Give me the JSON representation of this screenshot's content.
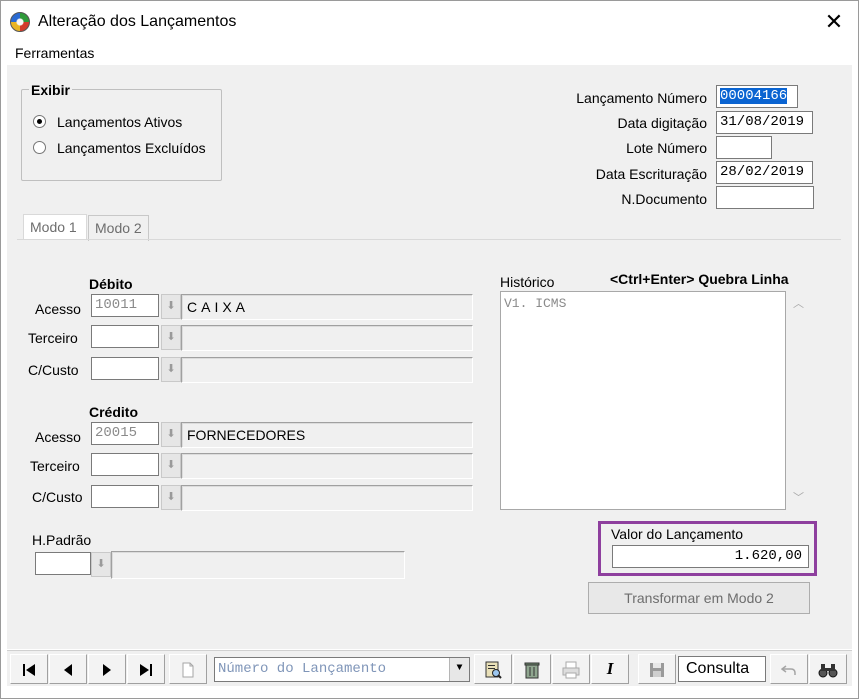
{
  "window": {
    "title": "Alteração dos Lançamentos",
    "close": "✕"
  },
  "menu": {
    "items": [
      "Ferramentas"
    ]
  },
  "exibir": {
    "title": "Exibir",
    "options": [
      {
        "label": "Lançamentos Ativos",
        "checked": true
      },
      {
        "label": "Lançamentos Excluídos",
        "checked": false
      }
    ]
  },
  "header_fields": {
    "lancamento_numero": {
      "label": "Lançamento Número",
      "value": "00004166"
    },
    "data_digitacao": {
      "label": "Data digitação",
      "value": "31/08/2019"
    },
    "lote_numero": {
      "label": "Lote Número",
      "value": ""
    },
    "data_escrituracao": {
      "label": "Data Escrituração",
      "value": "28/02/2019"
    },
    "n_documento": {
      "label": "N.Documento",
      "value": ""
    }
  },
  "tabs": [
    {
      "label": "Modo 1",
      "active": true
    },
    {
      "label": "Modo 2",
      "active": false
    }
  ],
  "debito": {
    "title": "Débito",
    "rows": [
      {
        "label": "Acesso",
        "code": "10011",
        "name": "CAIXA"
      },
      {
        "label": "Terceiro",
        "code": "",
        "name": ""
      },
      {
        "label": "C/Custo",
        "code": "",
        "name": ""
      }
    ]
  },
  "credito": {
    "title": "Crédito",
    "rows": [
      {
        "label": "Acesso",
        "code": "20015",
        "name": "FORNECEDORES"
      },
      {
        "label": "Terceiro",
        "code": "",
        "name": ""
      },
      {
        "label": "C/Custo",
        "code": "",
        "name": ""
      }
    ]
  },
  "hpadrao": {
    "label": "H.Padrão",
    "code": "",
    "name": ""
  },
  "historico": {
    "label": "Histórico",
    "hint": "<Ctrl+Enter> Quebra Linha",
    "text": "V1. ICMS"
  },
  "valor": {
    "label": "Valor do Lançamento",
    "value": "1.620,00"
  },
  "transform_button": "Transformar em Modo 2",
  "toolbar": {
    "combo_placeholder": "Número do Lançamento",
    "status": "Consulta"
  },
  "colors": {
    "highlight": "#0a64d2",
    "valor_frame": "#8e3f9e"
  }
}
